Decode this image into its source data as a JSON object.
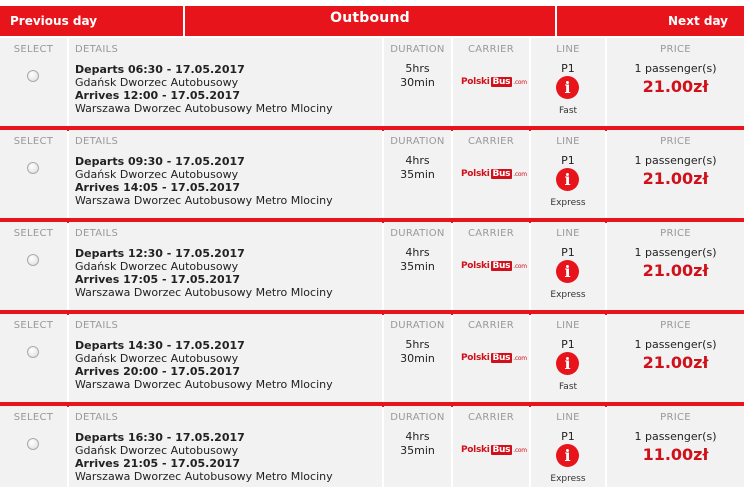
{
  "nav": {
    "prev_label": "Previous day",
    "title": "Outbound",
    "next_label": "Next day"
  },
  "columns": {
    "select": "SELECT",
    "details": "DETAILS",
    "duration": "DURATION",
    "carrier": "CARRIER",
    "line": "LINE",
    "price": "PRICE"
  },
  "carrier_logo": {
    "part1": "Polski",
    "part2": "Bus",
    "part3": ".com"
  },
  "info_glyph": "i",
  "icons": {
    "info": "info-circle-icon",
    "radio": "radio-button"
  },
  "colors": {
    "accent": "#e8141b",
    "price": "#d0101a",
    "cell_bg": "#f2f2f2"
  },
  "rows": [
    {
      "departs": "Departs 06:30 - 17.05.2017",
      "from": "Gdańsk Dworzec Autobusowy",
      "arrives": "Arrives 12:00 - 17.05.2017",
      "to": "Warszawa Dworzec Autobusowy Metro Mlociny",
      "dur_h": "5hrs",
      "dur_m": "30min",
      "line": "P1",
      "type": "Fast",
      "pax": "1 passenger(s)",
      "price": "21.00zł"
    },
    {
      "departs": "Departs 09:30 - 17.05.2017",
      "from": "Gdańsk Dworzec Autobusowy",
      "arrives": "Arrives 14:05 - 17.05.2017",
      "to": "Warszawa Dworzec Autobusowy Metro Mlociny",
      "dur_h": "4hrs",
      "dur_m": "35min",
      "line": "P1",
      "type": "Express",
      "pax": "1 passenger(s)",
      "price": "21.00zł"
    },
    {
      "departs": "Departs 12:30 - 17.05.2017",
      "from": "Gdańsk Dworzec Autobusowy",
      "arrives": "Arrives 17:05 - 17.05.2017",
      "to": "Warszawa Dworzec Autobusowy Metro Mlociny",
      "dur_h": "4hrs",
      "dur_m": "35min",
      "line": "P1",
      "type": "Express",
      "pax": "1 passenger(s)",
      "price": "21.00zł"
    },
    {
      "departs": "Departs 14:30 - 17.05.2017",
      "from": "Gdańsk Dworzec Autobusowy",
      "arrives": "Arrives 20:00 - 17.05.2017",
      "to": "Warszawa Dworzec Autobusowy Metro Mlociny",
      "dur_h": "5hrs",
      "dur_m": "30min",
      "line": "P1",
      "type": "Fast",
      "pax": "1 passenger(s)",
      "price": "21.00zł"
    },
    {
      "departs": "Departs 16:30 - 17.05.2017",
      "from": "Gdańsk Dworzec Autobusowy",
      "arrives": "Arrives 21:05 - 17.05.2017",
      "to": "Warszawa Dworzec Autobusowy Metro Mlociny",
      "dur_h": "4hrs",
      "dur_m": "35min",
      "line": "P1",
      "type": "Express",
      "pax": "1 passenger(s)",
      "price": "11.00zł"
    }
  ]
}
